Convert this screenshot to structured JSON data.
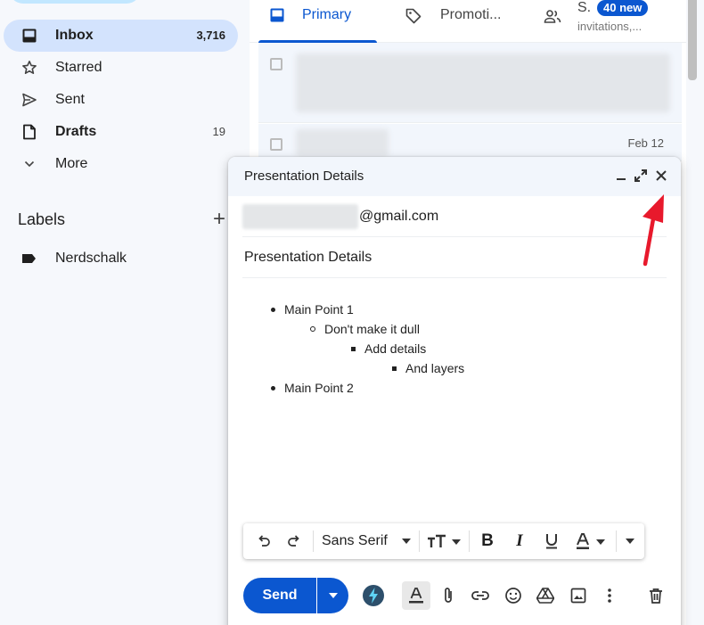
{
  "sidebar": {
    "items": [
      {
        "label": "Inbox",
        "count": "3,716"
      },
      {
        "label": "Starred"
      },
      {
        "label": "Sent"
      },
      {
        "label": "Drafts",
        "count": "19"
      },
      {
        "label": "More"
      }
    ],
    "labels_heading": "Labels",
    "labels": [
      {
        "label": "Nerdschalk"
      }
    ]
  },
  "tabs": [
    {
      "label": "Primary",
      "icon": "inbox-tab-icon"
    },
    {
      "label": "Promoti..."
    },
    {
      "label": "S.",
      "badge": "40 new",
      "subtext": "invitations,..."
    }
  ],
  "rows": [
    {
      "date": ""
    },
    {
      "date": "Feb 12"
    }
  ],
  "compose": {
    "title": "Presentation Details",
    "to_suffix": "@gmail.com",
    "subject": "Presentation Details",
    "body": [
      {
        "text": "Main Point 1",
        "level": 1
      },
      {
        "text": "Don't make it dull",
        "level": 2
      },
      {
        "text": "Add details",
        "level": 3
      },
      {
        "text": "And layers",
        "level": 4
      },
      {
        "text": "Main Point 2",
        "level": 1
      }
    ],
    "font": "Sans Serif",
    "send_label": "Send"
  },
  "colors": {
    "accent": "#0b57d0",
    "annotation_arrow": "#e8192c"
  }
}
